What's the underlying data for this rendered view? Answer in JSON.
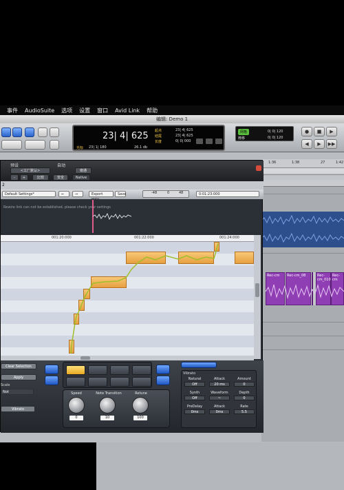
{
  "menubar": {
    "items": [
      "事件",
      "AudioSuite",
      "选项",
      "设置",
      "窗口",
      "Avid Link",
      "帮助"
    ]
  },
  "window": {
    "title": "编辑: Demo 1"
  },
  "counter": {
    "main": "23| 4| 625",
    "start_label": "起点",
    "start_value": "23| 4| 625",
    "end_label": "结尾",
    "end_value": "23| 4| 625",
    "length_label": "长度",
    "length_value": "0| 0| 000",
    "cursor_label": "光标",
    "cursor_value": "23| 1| 180",
    "cursor_sample": "26.1 db"
  },
  "grid": {
    "label": "网格",
    "value": "0| 0| 120",
    "nudge_label": "微移",
    "nudge_value": "0| 0| 120"
  },
  "ruler": {
    "marks": [
      "1:36",
      "1:38",
      "27",
      "1:42"
    ]
  },
  "plugin": {
    "preset_label": "预设",
    "auto_label": "自动",
    "preset_value": "<工厂默认>",
    "compare_label": "比较",
    "bypass_label": "旁通",
    "safe_label": "安全",
    "native_label": "Native",
    "track_num": "2",
    "settings_name": "Default Settings*",
    "export_label": "Export MIDI",
    "save_label": "Save",
    "meter_marks": [
      "-48",
      "0",
      "48"
    ],
    "position_value": "0:01:23:000",
    "warning": "Rewire link can not be established, please check your settings",
    "ruler_marks": [
      "001:20:000",
      "001:22:000",
      "001:24:000"
    ]
  },
  "tools": {
    "clear_label": "Clear Selection",
    "apply_label": "Apply",
    "scale_label": "Scale",
    "scale_value": "Not",
    "vibrato_label": "Vibrato",
    "knobs": [
      {
        "label": "Speed",
        "value": "0"
      },
      {
        "label": "Note Transition",
        "value": "10"
      },
      {
        "label": "Retune",
        "value": "100"
      }
    ]
  },
  "vibrato_panel": {
    "title": "Vibrato",
    "row1": [
      {
        "label": "Natural",
        "value": "Off"
      },
      {
        "label": "Attack",
        "value": "20 ms"
      },
      {
        "label": "Amount",
        "value": "0"
      }
    ],
    "row2": [
      {
        "label": "Synth",
        "value": "Off"
      },
      {
        "label": "Waveform",
        "value": "~"
      },
      {
        "label": "Depth",
        "value": "0"
      }
    ],
    "row3": [
      {
        "label": "PreDelay",
        "value": "0ms"
      },
      {
        "label": "Attack",
        "value": "0ms"
      },
      {
        "label": "Rate",
        "value": "5.5"
      }
    ]
  },
  "clips": [
    {
      "name": "Rec-cm"
    },
    {
      "name": "Rec-cm_08"
    },
    {
      "name": "Rec-cm_010"
    },
    {
      "name": "Rec-cm"
    }
  ],
  "colors": {
    "clip_purple": "#8f3fb3",
    "note_orange": "#f0b058",
    "waveform_blue": "#3457a8"
  }
}
